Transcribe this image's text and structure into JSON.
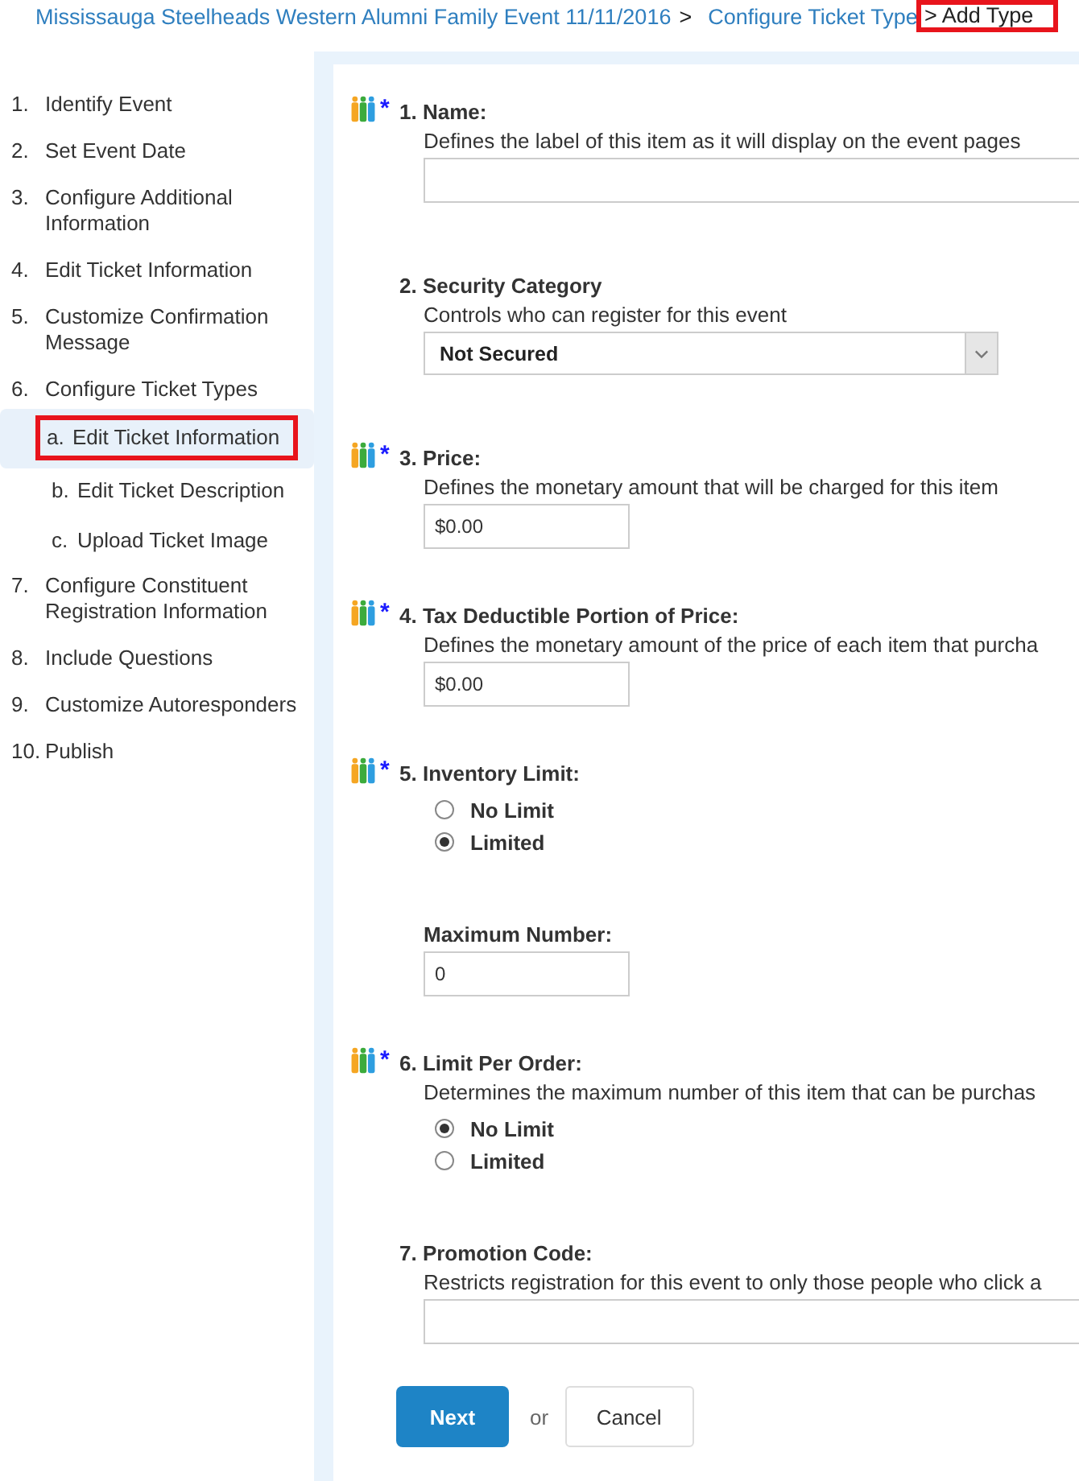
{
  "breadcrumb": [
    {
      "label": "Mississauga Steelheads Western Alumni Family Event 11/11/2016",
      "kind": "link",
      "highlighted": false
    },
    {
      "label": ">",
      "kind": "separator",
      "highlighted": false
    },
    {
      "label": "Configure Ticket Type",
      "kind": "link",
      "highlighted": false
    },
    {
      "label": "> Add Type",
      "kind": "current",
      "highlighted": true
    }
  ],
  "sidebar": {
    "items": [
      {
        "number": "1.",
        "label": "Identify Event",
        "selected": false,
        "highlighted": false
      },
      {
        "number": "2.",
        "label": "Set Event Date",
        "selected": false,
        "highlighted": false
      },
      {
        "number": "3.",
        "label": "Configure Additional Information",
        "selected": false,
        "highlighted": false
      },
      {
        "number": "4.",
        "label": "Edit Ticket Information",
        "selected": false,
        "highlighted": false
      },
      {
        "number": "5.",
        "label": "Customize Confirmation Message",
        "selected": false,
        "highlighted": false
      },
      {
        "number": "6.",
        "label": "Configure Ticket Types",
        "selected": false,
        "highlighted": false,
        "children": [
          {
            "number": "a.",
            "label": "Edit Ticket Information",
            "selected": true,
            "highlighted": true
          },
          {
            "number": "b.",
            "label": "Edit Ticket Description",
            "selected": false,
            "highlighted": false
          },
          {
            "number": "c.",
            "label": "Upload Ticket Image",
            "selected": false,
            "highlighted": false
          }
        ]
      },
      {
        "number": "7.",
        "label": "Configure Constituent Registration Information",
        "selected": false,
        "highlighted": false
      },
      {
        "number": "8.",
        "label": "Include Questions",
        "selected": false,
        "highlighted": false
      },
      {
        "number": "9.",
        "label": "Customize Autoresponders",
        "selected": false,
        "highlighted": false
      },
      {
        "number": "10.",
        "label": "Publish",
        "selected": false,
        "highlighted": false
      }
    ]
  },
  "fields": [
    {
      "kind": "text",
      "label": "1. Name:",
      "required": true,
      "description": "Defines the label of this item as it will display on the event pages"
    },
    {
      "kind": "select",
      "label": "2. Security Category",
      "required": false,
      "description": "Controls who can register for this event",
      "value": "Not Secured"
    },
    {
      "kind": "amount",
      "label": "3. Price:",
      "required": true,
      "description": "Defines the monetary amount that will be charged for this item",
      "value": "$0.00"
    },
    {
      "kind": "amount",
      "label": "4. Tax Deductible Portion of Price:",
      "required": true,
      "description": "Defines the monetary amount of the price of each item that purcha",
      "value": "$0.00"
    },
    {
      "kind": "radio",
      "label": "5. Inventory Limit:",
      "required": true,
      "options": [
        {
          "label": "No Limit",
          "selected": false
        },
        {
          "label": "Limited",
          "selected": true
        }
      ],
      "subfield": {
        "label": "Maximum Number:",
        "value": "0"
      }
    },
    {
      "kind": "radio",
      "label": "6. Limit Per Order:",
      "required": true,
      "description": "Determines the maximum number of this item that can be purchas",
      "options": [
        {
          "label": "No Limit",
          "selected": true
        },
        {
          "label": "Limited",
          "selected": false
        }
      ]
    },
    {
      "kind": "text",
      "label": "7. Promotion Code:",
      "required": false,
      "description": "Restricts registration for this event to only those people who click a"
    }
  ],
  "required_marker": "*",
  "actions": {
    "primary": "Next",
    "separator": "or",
    "secondary": "Cancel"
  }
}
